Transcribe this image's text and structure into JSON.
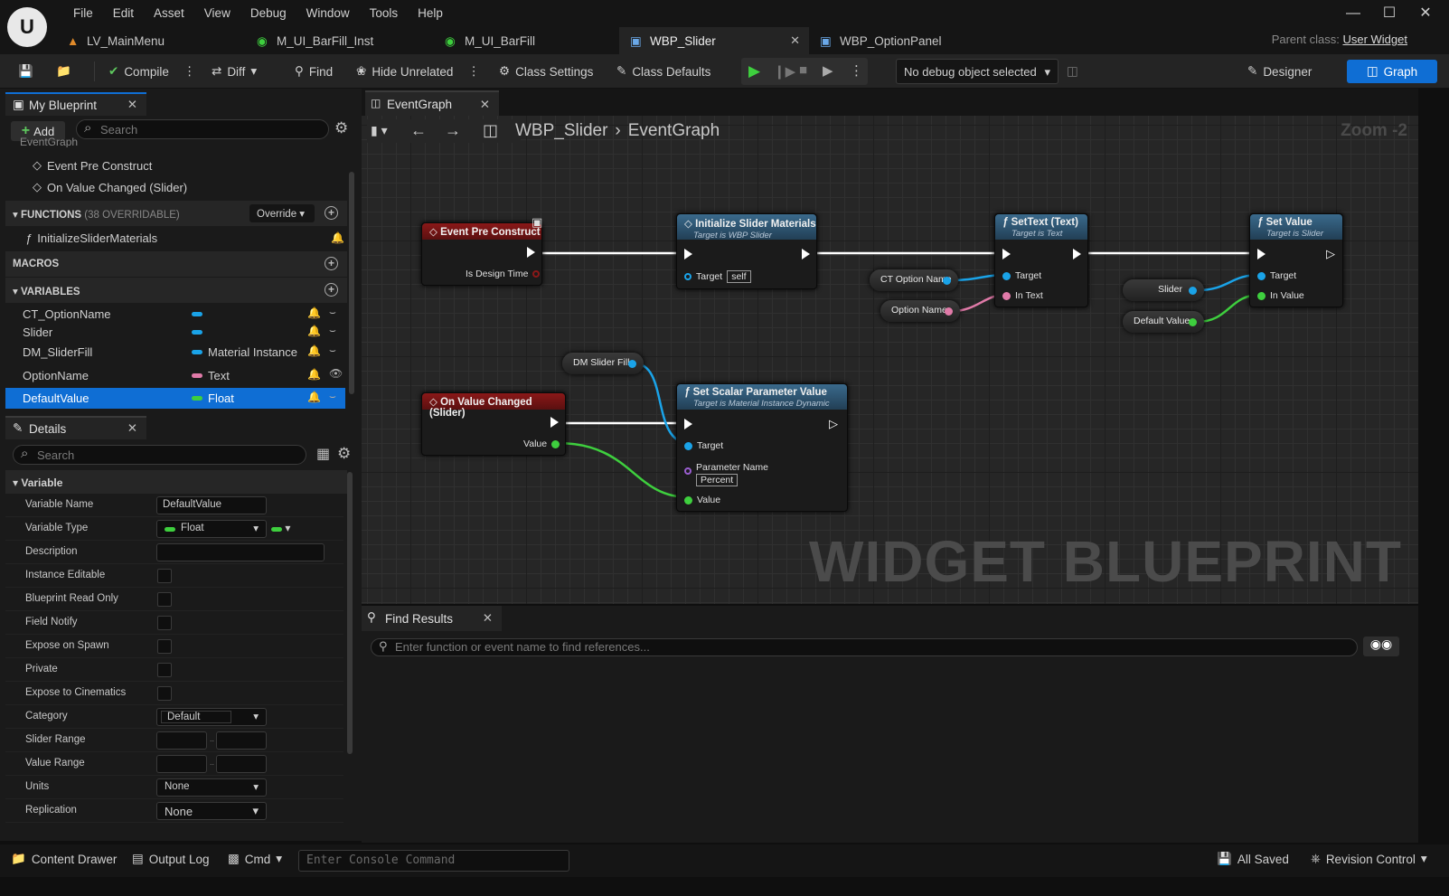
{
  "menu": [
    "File",
    "Edit",
    "Asset",
    "View",
    "Debug",
    "Window",
    "Tools",
    "Help"
  ],
  "tabs": [
    {
      "label": "LV_MainMenu"
    },
    {
      "label": "M_UI_BarFill_Inst"
    },
    {
      "label": "M_UI_BarFill"
    },
    {
      "label": "WBP_Slider",
      "active": true
    },
    {
      "label": "WBP_OptionPanel"
    }
  ],
  "parent_class": {
    "label": "Parent class:",
    "value": "User Widget"
  },
  "toolbar": {
    "compile": "Compile",
    "diff": "Diff",
    "find": "Find",
    "hide_unrelated": "Hide Unrelated",
    "class_settings": "Class Settings",
    "class_defaults": "Class Defaults",
    "debug_object": "No debug object selected",
    "designer": "Designer",
    "graph": "Graph"
  },
  "my_blueprint": {
    "tab": "My Blueprint",
    "add": "Add",
    "search_placeholder": "Search",
    "graph_header": "EventGraph",
    "events": [
      "Event Pre Construct",
      "On Value Changed (Slider)"
    ],
    "functions": {
      "title": "FUNCTIONS",
      "count": "(38 OVERRIDABLE)",
      "override": "Override",
      "items": [
        "InitializeSliderMaterials"
      ]
    },
    "macros": "MACROS",
    "variables": {
      "title": "VARIABLES",
      "items": [
        {
          "name": "CT_OptionName",
          "type": "",
          "color": "#1aa3e8"
        },
        {
          "name": "Slider",
          "type": "",
          "color": "#1aa3e8"
        },
        {
          "name": "DM_SliderFill",
          "type": "Material Instance",
          "color": "#1aa3e8"
        },
        {
          "name": "OptionName",
          "type": "Text",
          "color": "#e07aa8"
        },
        {
          "name": "DefaultValue",
          "type": "Float",
          "color": "#3ecf3e",
          "selected": true
        }
      ]
    }
  },
  "details": {
    "tab": "Details",
    "search_placeholder": "Search",
    "section": "Variable",
    "rows": {
      "variable_name": {
        "label": "Variable Name",
        "value": "DefaultValue"
      },
      "variable_type": {
        "label": "Variable Type",
        "value": "Float"
      },
      "description": {
        "label": "Description",
        "value": ""
      },
      "instance_editable": "Instance Editable",
      "blueprint_read_only": "Blueprint Read Only",
      "field_notify": "Field Notify",
      "expose_on_spawn": "Expose on Spawn",
      "private": "Private",
      "expose_to_cinematics": "Expose to Cinematics",
      "category": {
        "label": "Category",
        "value": "Default"
      },
      "slider_range": "Slider Range",
      "value_range": "Value Range",
      "units": {
        "label": "Units",
        "value": "None"
      },
      "replication": {
        "label": "Replication",
        "value": "None"
      }
    }
  },
  "graph": {
    "tab": "EventGraph",
    "crumb_root": "WBP_Slider",
    "crumb_leaf": "EventGraph",
    "zoom": "Zoom -2",
    "watermark": "WIDGET BLUEPRINT",
    "nodes": {
      "event_pre": {
        "title": "Event Pre Construct",
        "pin": "Is Design Time"
      },
      "init": {
        "title": "Initialize Slider Materials",
        "sub": "Target is WBP Slider",
        "target": "Target",
        "self": "self"
      },
      "settext": {
        "title": "SetText (Text)",
        "sub": "Target is Text",
        "target": "Target",
        "intext": "In Text"
      },
      "setvalue": {
        "title": "Set Value",
        "sub": "Target is Slider",
        "target": "Target",
        "invalue": "In Value"
      },
      "onchanged": {
        "title": "On Value Changed (Slider)",
        "pin": "Value"
      },
      "setscalar": {
        "title": "Set Scalar Parameter Value",
        "sub": "Target is Material Instance Dynamic",
        "target": "Target",
        "param": "Parameter Name",
        "param_value": "Percent",
        "value": "Value"
      }
    },
    "vars": {
      "ct": "CT Option Name",
      "opt": "Option Name",
      "slider": "Slider",
      "default": "Default Value",
      "dm": "DM Slider Fill"
    }
  },
  "find_results": {
    "tab": "Find Results",
    "placeholder": "Enter function or event name to find references..."
  },
  "status": {
    "content_drawer": "Content Drawer",
    "output_log": "Output Log",
    "cmd": "Cmd",
    "console_placeholder": "Enter Console Command",
    "all_saved": "All Saved",
    "revision": "Revision Control"
  }
}
